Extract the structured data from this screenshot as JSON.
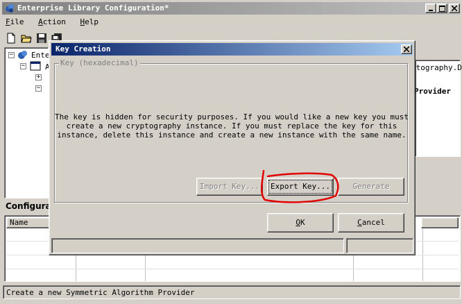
{
  "app": {
    "title": "Enterprise Library Configuration*",
    "menu": [
      "File",
      "Action",
      "Help"
    ],
    "tree": {
      "root_label": "Ente",
      "child_label": "A"
    },
    "right_panel": {
      "header_fragment": "ptography.D",
      "provider_label": "Provider"
    },
    "config_panel": {
      "title": "Configurati"
    },
    "table": {
      "columns": [
        "Name"
      ]
    },
    "status_bar": "Create a new Symmetric Algorithm Provider",
    "colors": {
      "titlebar_start": "#808080",
      "titlebar_end": "#c0c0c0",
      "dialog_title_start": "#0a246a",
      "dialog_title_end": "#a6caf0",
      "annotation": "#e00000"
    }
  },
  "dialog": {
    "title": "Key Creation",
    "group_label": "Key (hexadecimal)",
    "message_lines": [
      "The key is hidden for security purposes.  If you would like a new key you must",
      "create a new cryptography instance.  If you must replace the key for this",
      "instance, delete this instance and create a new instance with the same name."
    ],
    "buttons": {
      "import": "Import Key...",
      "export": "Export Key...",
      "generate": "Generate",
      "ok": "OK",
      "cancel": "Cancel"
    }
  }
}
